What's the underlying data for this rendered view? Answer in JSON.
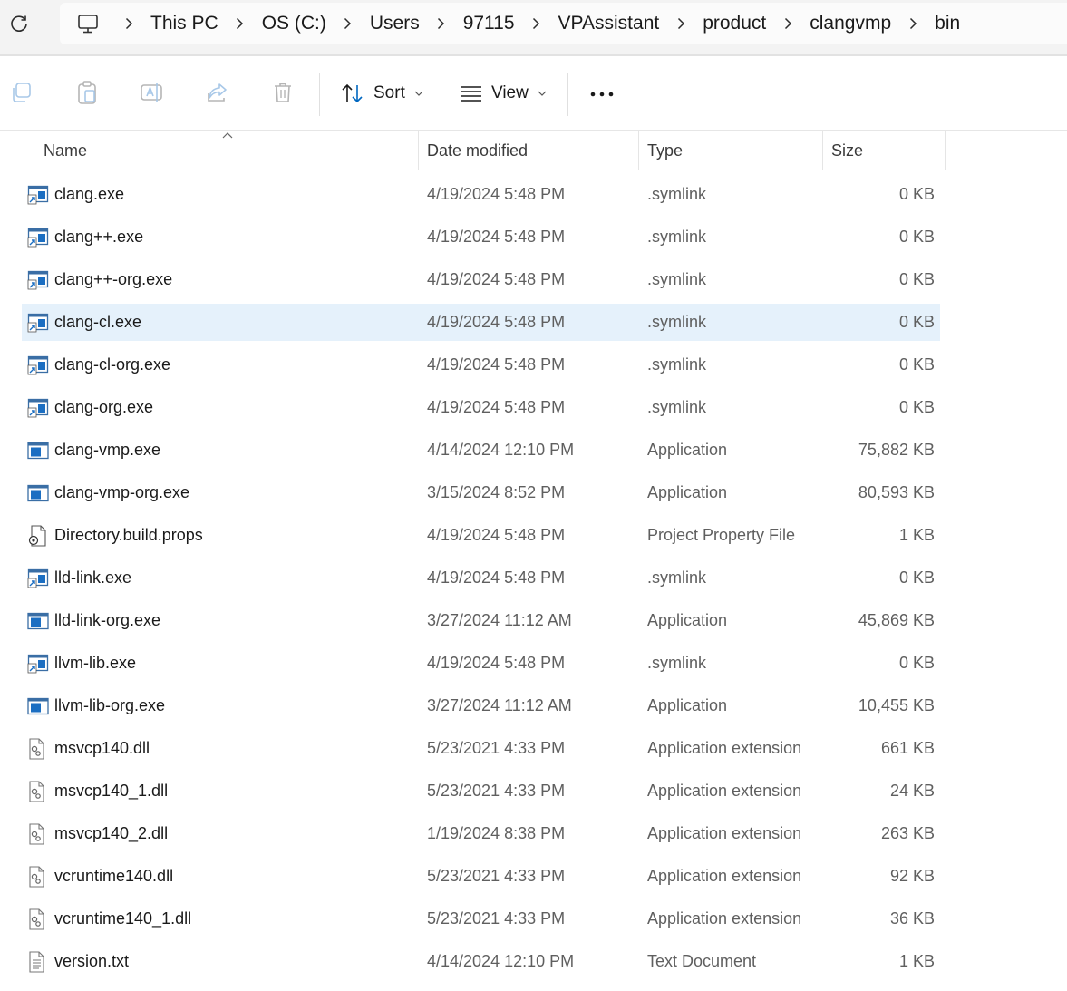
{
  "breadcrumb": {
    "items": [
      {
        "label": "This PC"
      },
      {
        "label": "OS (C:)"
      },
      {
        "label": "Users"
      },
      {
        "label": "97115"
      },
      {
        "label": "VPAssistant"
      },
      {
        "label": "product"
      },
      {
        "label": "clangvmp"
      },
      {
        "label": "bin"
      }
    ]
  },
  "toolbar": {
    "sort_label": "Sort",
    "view_label": "View"
  },
  "columns": {
    "name": "Name",
    "date": "Date modified",
    "type": "Type",
    "size": "Size"
  },
  "files": [
    {
      "name": "clang.exe",
      "date": "4/19/2024 5:48 PM",
      "type": ".symlink",
      "size": "0 KB",
      "icon": "symlink-icon"
    },
    {
      "name": "clang++.exe",
      "date": "4/19/2024 5:48 PM",
      "type": ".symlink",
      "size": "0 KB",
      "icon": "symlink-icon"
    },
    {
      "name": "clang++-org.exe",
      "date": "4/19/2024 5:48 PM",
      "type": ".symlink",
      "size": "0 KB",
      "icon": "symlink-icon"
    },
    {
      "name": "clang-cl.exe",
      "date": "4/19/2024 5:48 PM",
      "type": ".symlink",
      "size": "0 KB",
      "icon": "symlink-icon",
      "selected": true
    },
    {
      "name": "clang-cl-org.exe",
      "date": "4/19/2024 5:48 PM",
      "type": ".symlink",
      "size": "0 KB",
      "icon": "symlink-icon"
    },
    {
      "name": "clang-org.exe",
      "date": "4/19/2024 5:48 PM",
      "type": ".symlink",
      "size": "0 KB",
      "icon": "symlink-icon"
    },
    {
      "name": "clang-vmp.exe",
      "date": "4/14/2024 12:10 PM",
      "type": "Application",
      "size": "75,882 KB",
      "icon": "application-icon"
    },
    {
      "name": "clang-vmp-org.exe",
      "date": "3/15/2024 8:52 PM",
      "type": "Application",
      "size": "80,593 KB",
      "icon": "application-icon"
    },
    {
      "name": "Directory.build.props",
      "date": "4/19/2024 5:48 PM",
      "type": "Project Property File",
      "size": "1 KB",
      "icon": "props-file-icon"
    },
    {
      "name": "lld-link.exe",
      "date": "4/19/2024 5:48 PM",
      "type": ".symlink",
      "size": "0 KB",
      "icon": "symlink-icon"
    },
    {
      "name": "lld-link-org.exe",
      "date": "3/27/2024 11:12 AM",
      "type": "Application",
      "size": "45,869 KB",
      "icon": "application-icon"
    },
    {
      "name": "llvm-lib.exe",
      "date": "4/19/2024 5:48 PM",
      "type": ".symlink",
      "size": "0 KB",
      "icon": "symlink-icon"
    },
    {
      "name": "llvm-lib-org.exe",
      "date": "3/27/2024 11:12 AM",
      "type": "Application",
      "size": "10,455 KB",
      "icon": "application-icon"
    },
    {
      "name": "msvcp140.dll",
      "date": "5/23/2021 4:33 PM",
      "type": "Application extension",
      "size": "661 KB",
      "icon": "dll-icon"
    },
    {
      "name": "msvcp140_1.dll",
      "date": "5/23/2021 4:33 PM",
      "type": "Application extension",
      "size": "24 KB",
      "icon": "dll-icon"
    },
    {
      "name": "msvcp140_2.dll",
      "date": "1/19/2024 8:38 PM",
      "type": "Application extension",
      "size": "263 KB",
      "icon": "dll-icon"
    },
    {
      "name": "vcruntime140.dll",
      "date": "5/23/2021 4:33 PM",
      "type": "Application extension",
      "size": "92 KB",
      "icon": "dll-icon"
    },
    {
      "name": "vcruntime140_1.dll",
      "date": "5/23/2021 4:33 PM",
      "type": "Application extension",
      "size": "36 KB",
      "icon": "dll-icon"
    },
    {
      "name": "version.txt",
      "date": "4/14/2024 12:10 PM",
      "type": "Text Document",
      "size": "1 KB",
      "icon": "text-file-icon"
    }
  ],
  "colors": {
    "selected_row": "#e5f1fb",
    "accent": "#0067c0"
  }
}
